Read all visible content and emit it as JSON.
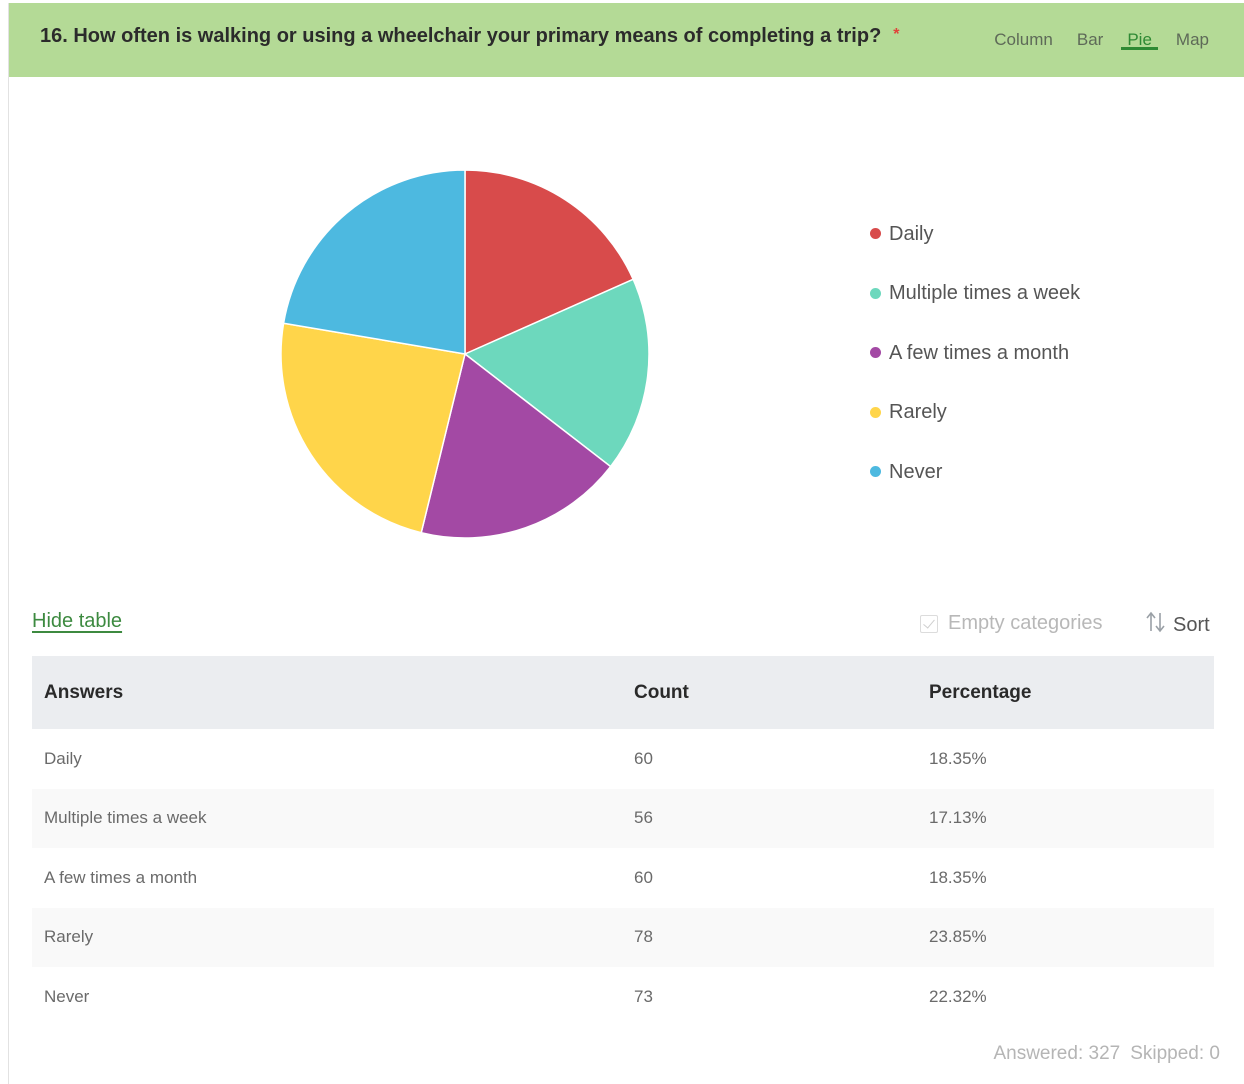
{
  "question": {
    "text": "16. How often is walking or using a wheelchair your primary means of completing a trip?",
    "required_mark": "*"
  },
  "view_tabs": [
    {
      "label": "Column",
      "active": false
    },
    {
      "label": "Bar",
      "active": false
    },
    {
      "label": "Pie",
      "active": true
    },
    {
      "label": "Map",
      "active": false
    }
  ],
  "colors": {
    "header_bg": "#b4da96",
    "active_tab": "#2f8a34"
  },
  "chart_data": {
    "type": "pie",
    "title": "",
    "categories": [
      "Daily",
      "Multiple times a week",
      "A few times a month",
      "Rarely",
      "Never"
    ],
    "values": [
      60,
      56,
      60,
      78,
      73
    ],
    "colors": [
      "#d84b4b",
      "#6dd8bd",
      "#a349a4",
      "#ffd54a",
      "#4db9e0"
    ],
    "start_angle": "12 o'clock",
    "direction": "clockwise",
    "legend_position": "right"
  },
  "table_controls": {
    "hide_table": "Hide table",
    "empty_categories": "Empty categories",
    "sort": "Sort"
  },
  "table": {
    "headers": [
      "Answers",
      "Count",
      "Percentage"
    ],
    "rows": [
      [
        "Daily",
        "60",
        "18.35%"
      ],
      [
        "Multiple times a week",
        "56",
        "17.13%"
      ],
      [
        "A few times a month",
        "60",
        "18.35%"
      ],
      [
        "Rarely",
        "78",
        "23.85%"
      ],
      [
        "Never",
        "73",
        "22.32%"
      ]
    ]
  },
  "summary": {
    "answered": "Answered: 327",
    "skipped": "Skipped: 0"
  }
}
